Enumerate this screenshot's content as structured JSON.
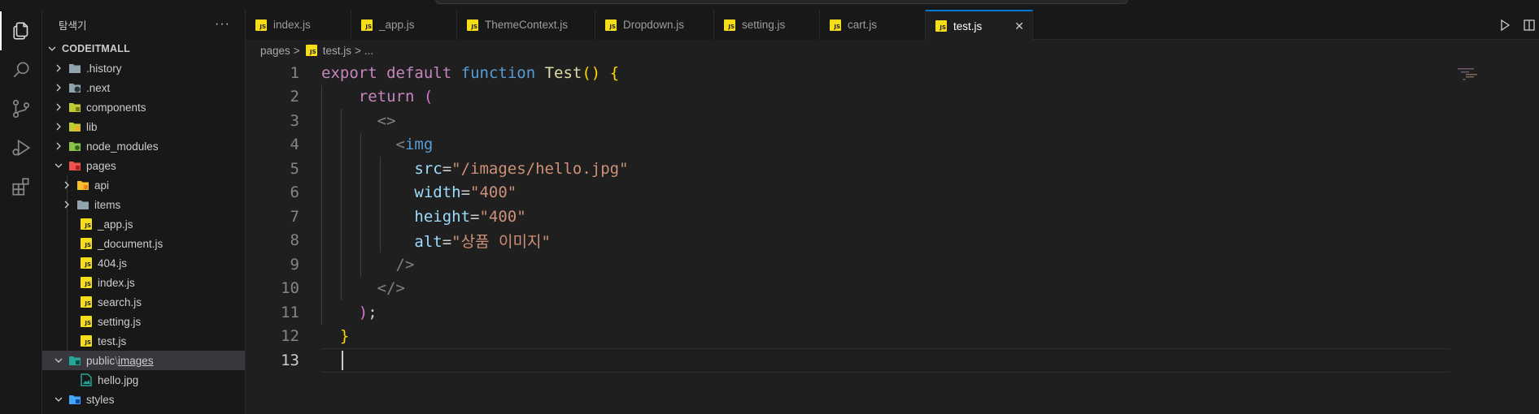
{
  "explorer": {
    "title": "탐색기",
    "more_label": "···",
    "root": "CODEITMALL",
    "items": [
      {
        "label": "history",
        "display": ".history"
      },
      {
        "label": "next",
        "display": ".next"
      },
      {
        "label": "components",
        "display": "components"
      },
      {
        "label": "lib",
        "display": "lib"
      },
      {
        "label": "node_modules",
        "display": "node_modules"
      },
      {
        "label": "pages",
        "display": "pages"
      },
      {
        "label": "api",
        "display": "api"
      },
      {
        "label": "items",
        "display": "items"
      },
      {
        "label": "_app.js",
        "display": "_app.js"
      },
      {
        "label": "_document.js",
        "display": "_document.js"
      },
      {
        "label": "404.js",
        "display": "404.js"
      },
      {
        "label": "index.js",
        "display": "index.js"
      },
      {
        "label": "search.js",
        "display": "search.js"
      },
      {
        "label": "setting.js",
        "display": "setting.js"
      },
      {
        "label": "test.js",
        "display": "test.js"
      },
      {
        "label": "public",
        "display": "public"
      },
      {
        "label": "images",
        "display": "images"
      },
      {
        "label": "hello.jpg",
        "display": "hello.jpg"
      },
      {
        "label": "styles",
        "display": "styles"
      }
    ],
    "path_separator": "\\"
  },
  "tabs": [
    "index.js",
    "_app.js",
    "ThemeContext.js",
    "Dropdown.js",
    "setting.js",
    "cart.js",
    "test.js"
  ],
  "active_tab": "test.js",
  "js_badge": "JS",
  "close_glyph": "✕",
  "breadcrumb": {
    "folder": "pages",
    "file": "test.js",
    "sep": ">",
    "ellipsis": "..."
  },
  "code_lines": [
    {
      "n": "1"
    },
    {
      "n": "2"
    },
    {
      "n": "3"
    },
    {
      "n": "4"
    },
    {
      "n": "5"
    },
    {
      "n": "6"
    },
    {
      "n": "7"
    },
    {
      "n": "8"
    },
    {
      "n": "9"
    },
    {
      "n": "10"
    },
    {
      "n": "11"
    },
    {
      "n": "12"
    },
    {
      "n": "13"
    }
  ],
  "code": {
    "export": "export",
    "default": "default",
    "function": "function",
    "name": "Test",
    "parens": "()",
    "brace_open": "{",
    "return": "return",
    "paren_open": "(",
    "frag_open": "<>",
    "img_lt": "<",
    "img": "img",
    "src_attr": "src",
    "src_val": "\"/images/hello.jpg\"",
    "width_attr": "width",
    "width_val": "\"400\"",
    "height_attr": "height",
    "height_val": "\"400\"",
    "alt_attr": "alt",
    "alt_val": "\"상품 이미지\"",
    "eq": "=",
    "self_close": "/>",
    "frag_close": "</>",
    "paren_close": ")",
    "semi": ";",
    "brace_close": "}"
  },
  "colors": {
    "accent": "#0078d4",
    "js_yellow": "#f5de19",
    "keyword": "#c586c0",
    "string": "#ce9178"
  }
}
